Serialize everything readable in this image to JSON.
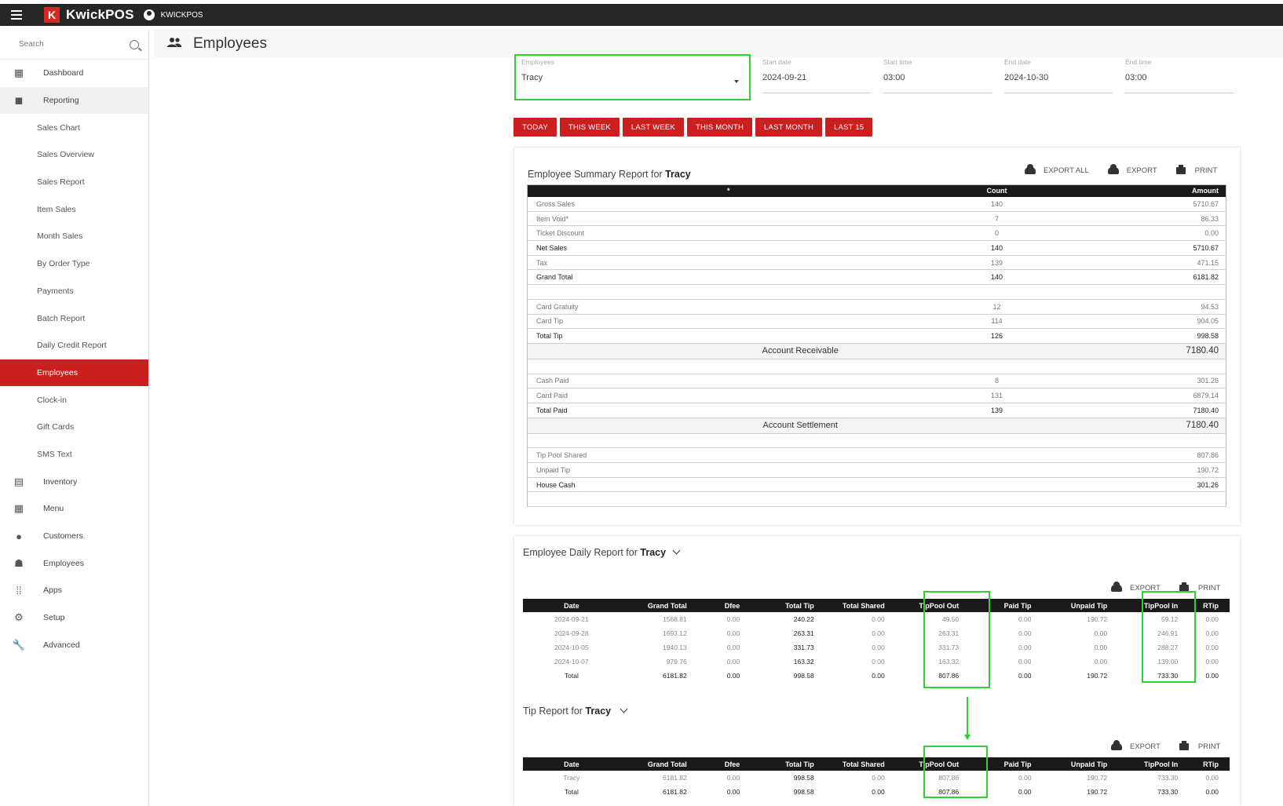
{
  "app": {
    "brand": "KwickPOS",
    "logo_letter": "K",
    "account": "KWICKPOS"
  },
  "sidebar": {
    "search_placeholder": "Search",
    "items": [
      {
        "label": "Dashboard",
        "icon": "dashboard-icon"
      },
      {
        "label": "Reporting",
        "icon": "reporting-icon"
      },
      {
        "label": "Sales Chart"
      },
      {
        "label": "Sales Overview"
      },
      {
        "label": "Sales Report"
      },
      {
        "label": "Item Sales"
      },
      {
        "label": "Month Sales"
      },
      {
        "label": "By Order Type"
      },
      {
        "label": "Payments"
      },
      {
        "label": "Batch Report"
      },
      {
        "label": "Daily Credit Report"
      },
      {
        "label": "Employees"
      },
      {
        "label": "Clock-in"
      },
      {
        "label": "Gift Cards"
      },
      {
        "label": "SMS Text"
      },
      {
        "label": "Inventory",
        "icon": "clipboard-icon"
      },
      {
        "label": "Menu",
        "icon": "grid-icon"
      },
      {
        "label": "Customers",
        "icon": "account-circle-icon"
      },
      {
        "label": "Employees",
        "icon": "people-icon"
      },
      {
        "label": "Apps",
        "icon": "apps-icon"
      },
      {
        "label": "Setup",
        "icon": "gear-icon"
      },
      {
        "label": "Advanced",
        "icon": "wrench-icon"
      }
    ]
  },
  "header": {
    "title": "Employees"
  },
  "filters": {
    "employees": {
      "label": "Employees",
      "value": "Tracy"
    },
    "start_date": {
      "label": "Start date",
      "value": "2024-09-21"
    },
    "start_time": {
      "label": "Start time",
      "value": "03:00"
    },
    "end_date": {
      "label": "End date",
      "value": "2024-10-30"
    },
    "end_time": {
      "label": "End time",
      "value": "03:00"
    }
  },
  "quick_buttons": [
    "TODAY",
    "THIS WEEK",
    "LAST WEEK",
    "THIS MONTH",
    "LAST MONTH",
    "LAST 15"
  ],
  "colors": {
    "accent": "#c9201f",
    "highlight": "#2ed12e",
    "topbar": "#262626"
  },
  "summary": {
    "title_prefix": "Employee Summary Report for",
    "employee": "Tracy",
    "actions": {
      "export_all": "EXPORT ALL",
      "export": "EXPORT",
      "print": "PRINT"
    },
    "columns": [
      "*",
      "Count",
      "Amount"
    ],
    "rows": [
      {
        "label": "Gross Sales",
        "count": "140",
        "amount": "5710.67"
      },
      {
        "label": "Item Void*",
        "count": "7",
        "amount": "86.33"
      },
      {
        "label": "Ticket Discount",
        "count": "0",
        "amount": "0.00"
      },
      {
        "label": "Net Sales",
        "count": "140",
        "amount": "5710.67",
        "bold": true
      },
      {
        "label": "Tax",
        "count": "139",
        "amount": "471.15"
      },
      {
        "label": "Grand Total",
        "count": "140",
        "amount": "6181.82",
        "bold": true
      },
      {
        "label": "",
        "count": "",
        "amount": ""
      },
      {
        "label": "Card Gratuity",
        "count": "12",
        "amount": "94.53"
      },
      {
        "label": "Card Tip",
        "count": "114",
        "amount": "904.05"
      },
      {
        "label": "Total Tip",
        "count": "126",
        "amount": "998.58",
        "bold": true
      },
      {
        "section": "Account Receivable",
        "amount": "7180.40"
      },
      {
        "label": "",
        "count": "",
        "amount": ""
      },
      {
        "label": "Cash Paid",
        "count": "8",
        "amount": "301.26"
      },
      {
        "label": "Card Paid",
        "count": "131",
        "amount": "6879.14"
      },
      {
        "label": "Total Paid",
        "count": "139",
        "amount": "7180.40",
        "bold": true
      },
      {
        "section": "Account Settlement",
        "amount": "7180.40"
      },
      {
        "label": "",
        "count": "",
        "amount": ""
      },
      {
        "label": "Tip Pool Shared",
        "count": "",
        "amount": "807.86"
      },
      {
        "label": "Unpaid Tip",
        "count": "",
        "amount": "190.72"
      },
      {
        "label": "House Cash",
        "count": "",
        "amount": "301.26",
        "bold": true
      },
      {
        "label": "",
        "count": "",
        "amount": ""
      }
    ]
  },
  "daily": {
    "title_prefix": "Employee Daily Report for",
    "employee": "Tracy",
    "actions": {
      "export": "EXPORT",
      "print": "PRINT"
    },
    "columns": [
      "Date",
      "Grand Total",
      "Dfee",
      "Total Tip",
      "Total Shared",
      "TipPool Out",
      "Paid Tip",
      "Unpaid Tip",
      "TipPool In",
      "RTip"
    ],
    "rows": [
      [
        "2024-09-21",
        "1568.81",
        "0.00",
        "240.22",
        "0.00",
        "49.50",
        "0.00",
        "190.72",
        "59.12",
        "0.00"
      ],
      [
        "2024-09-28",
        "1693.12",
        "0.00",
        "263.31",
        "0.00",
        "263.31",
        "0.00",
        "0.00",
        "246.91",
        "0.00"
      ],
      [
        "2024-10-05",
        "1940.13",
        "0.00",
        "331.73",
        "0.00",
        "331.73",
        "0.00",
        "0.00",
        "288.27",
        "0.00"
      ],
      [
        "2024-10-07",
        "979.76",
        "0.00",
        "163.32",
        "0.00",
        "163.32",
        "0.00",
        "0.00",
        "139.00",
        "0.00"
      ],
      [
        "Total",
        "6181.82",
        "0.00",
        "998.58",
        "0.00",
        "807.86",
        "0.00",
        "190.72",
        "733.30",
        "0.00"
      ]
    ]
  },
  "tip": {
    "title_prefix": "Tip Report for",
    "employee": "Tracy",
    "actions": {
      "export": "EXPORT",
      "print": "PRINT"
    },
    "columns": [
      "Date",
      "Grand Total",
      "Dfee",
      "Total Tip",
      "Total Shared",
      "TipPool Out",
      "Paid Tip",
      "Unpaid Tip",
      "TipPool In",
      "RTip"
    ],
    "rows": [
      [
        "Tracy",
        "6181.82",
        "0.00",
        "998.58",
        "0.00",
        "807.86",
        "0.00",
        "190.72",
        "733.30",
        "0.00"
      ],
      [
        "Total",
        "6181.82",
        "0.00",
        "998.58",
        "0.00",
        "807.86",
        "0.00",
        "190.72",
        "733.30",
        "0.00"
      ]
    ]
  }
}
